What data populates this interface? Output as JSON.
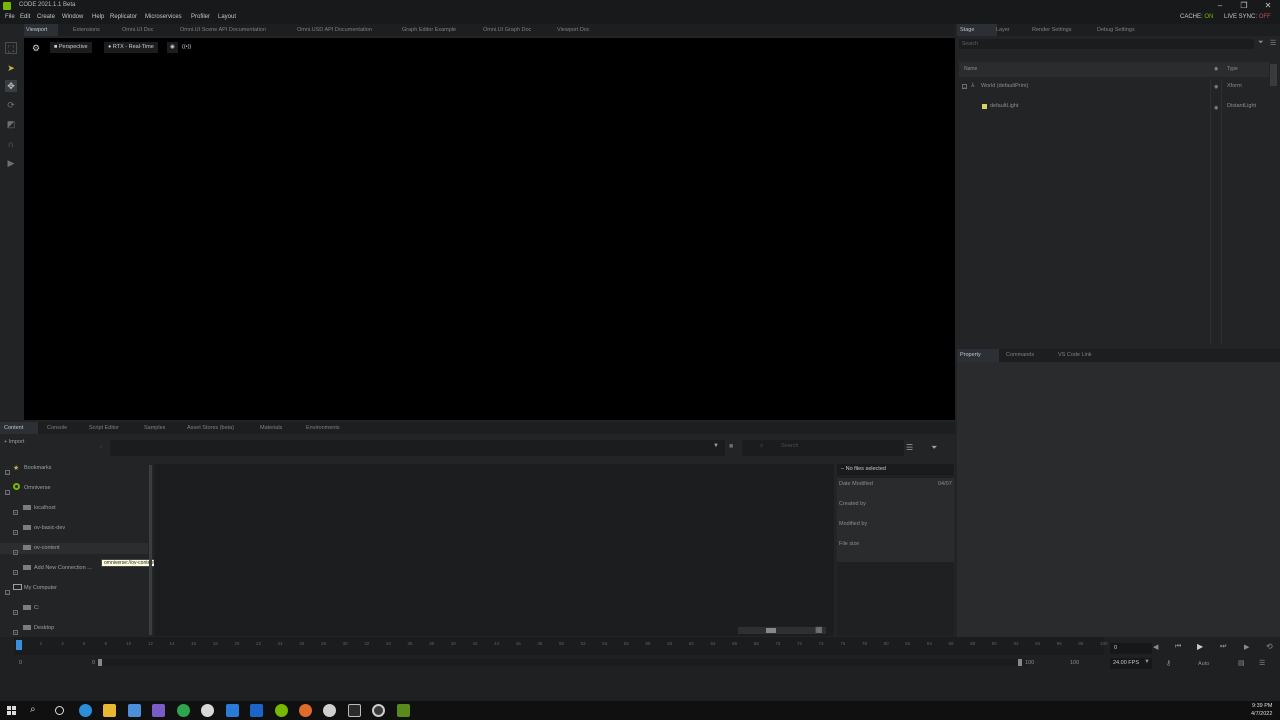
{
  "titlebar": {
    "title": "CODE 2021.1.1 Beta",
    "cache_label": "CACHE:",
    "cache_value": "ON",
    "livesync_label": "LIVE SYNC:",
    "livesync_value": "OFF"
  },
  "menu": [
    "File",
    "Edit",
    "Create",
    "Window",
    "Help",
    "Replicator",
    "Microservices",
    "Profiler",
    "Layout"
  ],
  "viewport_tabs": [
    "Viewport",
    "Extensions",
    "Omni.UI Doc",
    "Omni.UI Scene API Documentation",
    "Omni.USD API Documentation",
    "Graph Editor Example",
    "Omni.UI Graph Doc",
    "Viewport Doc"
  ],
  "viewport_toolbar": {
    "camera": "Perspective",
    "renderer": "RTX - Real-Time",
    "extra": "((•))"
  },
  "stage_tabs": [
    "Stage",
    "Layer",
    "Render Settings",
    "Debug Settings"
  ],
  "stage": {
    "search_placeholder": "Search",
    "col_name": "Name",
    "col_type": "Type",
    "items": [
      {
        "name": "World (defaultPrim)",
        "type": "Xform"
      },
      {
        "name": "defaultLight",
        "type": "DistantLight"
      }
    ]
  },
  "property_tabs": [
    "Property",
    "Commands",
    "VS Code Link"
  ],
  "content_tabs": [
    "Content",
    "Console",
    "Script Editor",
    "Samples",
    "Asset Stores (beta)",
    "Materials",
    "Environments"
  ],
  "content": {
    "import_label": "Import",
    "search_placeholder": "Search",
    "tree": [
      {
        "label": "Bookmarks"
      },
      {
        "label": "Omniverse"
      },
      {
        "label": "localhost"
      },
      {
        "label": "ov-basic-dev"
      },
      {
        "label": "ov-content"
      },
      {
        "label": "Add New Connection ..."
      },
      {
        "label": "My Computer"
      },
      {
        "label": "C:"
      },
      {
        "label": "Desktop"
      }
    ],
    "tooltip": "omniverse://ov-content",
    "details": {
      "header": "No files selected",
      "date_modified": "Date Modified",
      "date_value": "04/07",
      "created_by": "Created by",
      "modified_by": "Modified by",
      "file_size": "File size"
    }
  },
  "timeline": {
    "ticks": [
      "0",
      "2",
      "4",
      "6",
      "8",
      "10",
      "12",
      "14",
      "16",
      "18",
      "20",
      "22",
      "24",
      "26",
      "28",
      "30",
      "32",
      "34",
      "36",
      "38",
      "40",
      "42",
      "44",
      "46",
      "48",
      "50",
      "52",
      "54",
      "56",
      "58",
      "60",
      "62",
      "64",
      "66",
      "68",
      "70",
      "72",
      "74",
      "76",
      "78",
      "80",
      "82",
      "84",
      "86",
      "88",
      "90",
      "92",
      "94",
      "96",
      "98",
      "100"
    ],
    "start": "0",
    "range_start": "0",
    "range_end": "100",
    "end": "100",
    "current_frame": "0",
    "fps": "24.00 FPS",
    "auto": "Auto"
  },
  "taskbar": {
    "time": "9:39 PM",
    "date": "4/7/2022"
  }
}
